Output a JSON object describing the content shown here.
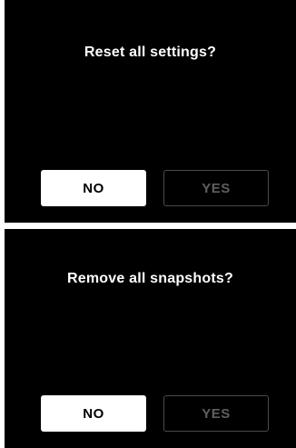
{
  "dialogs": [
    {
      "title": "Reset all settings?",
      "no_label": "NO",
      "yes_label": "YES"
    },
    {
      "title": "Remove all snapshots?",
      "no_label": "NO",
      "yes_label": "YES"
    }
  ],
  "colors": {
    "background": "#000000",
    "text": "#ffffff",
    "primary_button_bg": "#ffffff",
    "primary_button_text": "#000000",
    "secondary_button_text": "#5f5f5f",
    "secondary_button_border": "#4a4a4a",
    "separator": "#ffffff"
  }
}
